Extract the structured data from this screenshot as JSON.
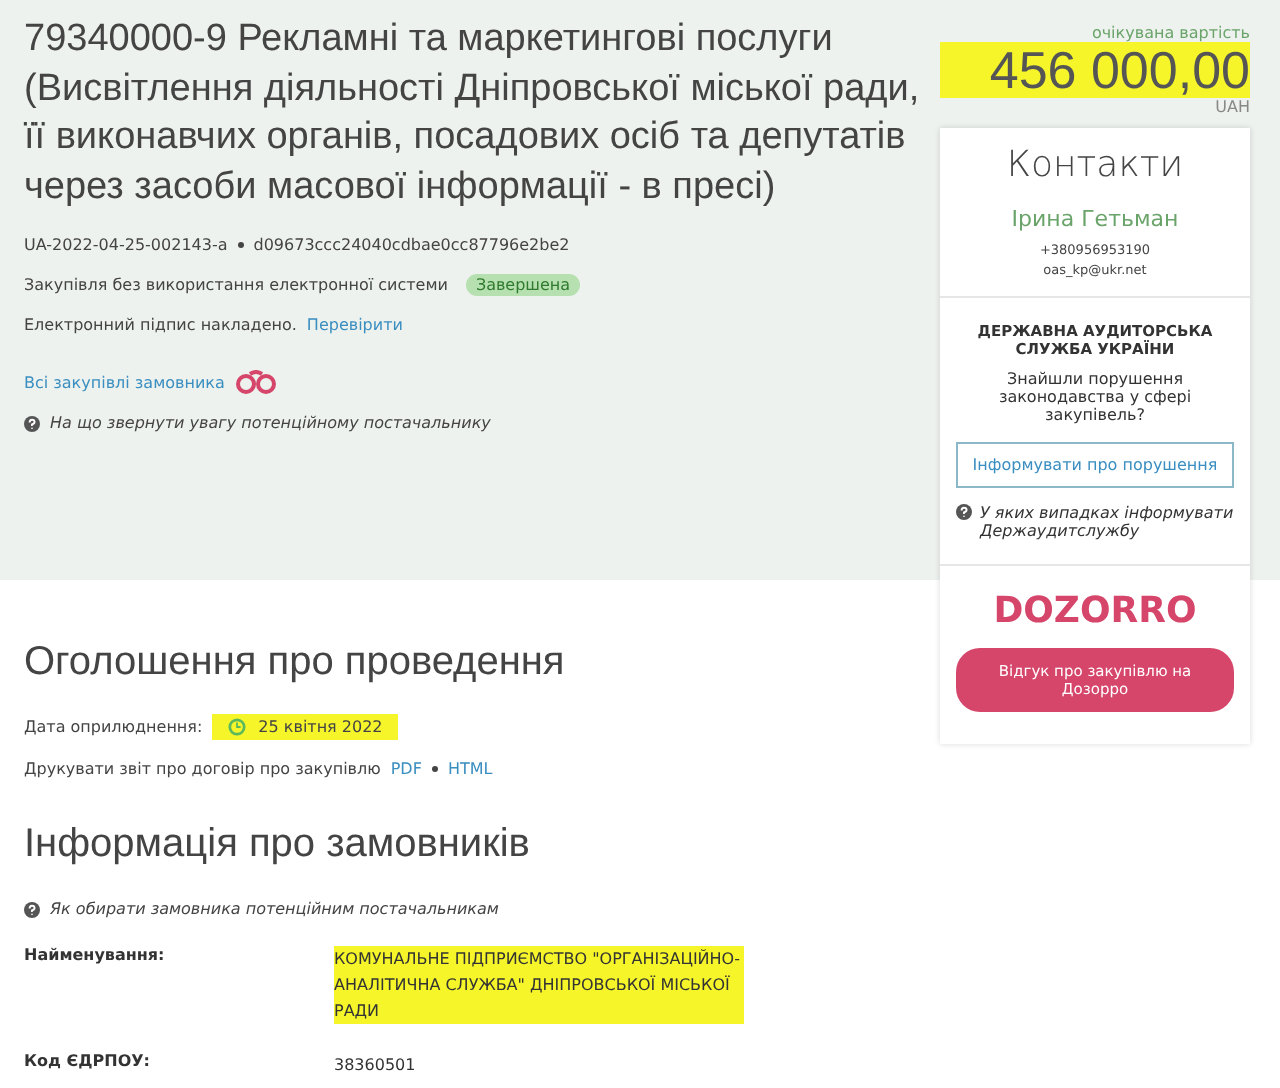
{
  "tender": {
    "title": "79340000-9 Рекламні та маркетингові послуги (Висвітлення діяльності Дніпровської міської ради, її виконавчих органів, посадових осіб та депутатів через засоби масової інформації - в пресі)",
    "id": "UA-2022-04-25-002143-a",
    "hash": "d09673ccc24040cdbae0cc87796e2be2",
    "method": "Закупівля без використання електронної системи",
    "status": "Завершена",
    "signature": "Електронний підпис накладено.",
    "verify_link": "Перевірити",
    "buyer_link": "Всі закупівлі замовника",
    "hint": "На що звернути увагу потенційному постачальнику"
  },
  "value": {
    "label": "очікувана вартість",
    "amount": "456 000,00",
    "currency": "UAH",
    "highlighted": true
  },
  "contacts": {
    "title": "Контакти",
    "name": "Ірина Гетьман",
    "phone": "+380956953190",
    "email": "oas_kp@ukr.net"
  },
  "audit": {
    "title": "ДЕРЖАВНА АУДИТОРСЬКА СЛУЖБА УКРАЇНИ",
    "question": "Знайшли порушення законодавства у сфері закупівель?",
    "button": "Інформувати про порушення",
    "hint": "У яких випадках інформувати Держаудитслужбу"
  },
  "dozorro": {
    "logo": "DOZORRO",
    "button": "Відгук про закупівлю на Дозорро"
  },
  "announcement": {
    "title": "Оголошення про проведення",
    "date_label": "Дата оприлюднення:",
    "date": "25 квітня 2022",
    "date_highlighted": true,
    "print_label": "Друкувати звіт про договір про закупівлю",
    "links": [
      "PDF",
      "HTML"
    ]
  },
  "buyers": {
    "title": "Інформація про замовників",
    "hint": "Як обирати замовника потенційним постачальникам",
    "fields": [
      {
        "label": "Найменування:",
        "value": "КОМУНАЛЬНЕ ПІДПРИЄМСТВО \"ОРГАНІЗАЦІЙНО-АНАЛІТИЧНА СЛУЖБА\" ДНІПРОВСЬКОЇ МІСЬКОЇ РАДИ",
        "highlighted": true
      },
      {
        "label": "Код ЄДРПОУ:",
        "value": "38360501",
        "highlighted": false
      }
    ]
  }
}
